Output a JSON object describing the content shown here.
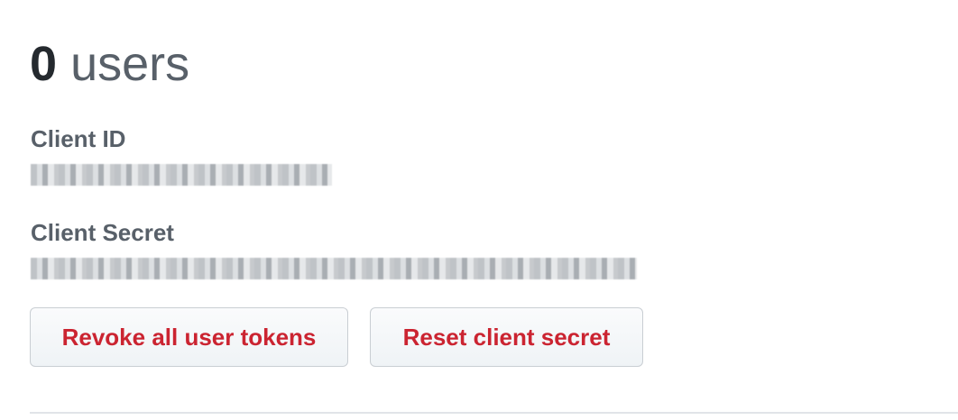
{
  "summary": {
    "count": "0",
    "unit": "users"
  },
  "client_id": {
    "label": "Client ID"
  },
  "client_secret": {
    "label": "Client Secret"
  },
  "actions": {
    "revoke_label": "Revoke all user tokens",
    "reset_label": "Reset client secret"
  },
  "colors": {
    "danger": "#cb2431",
    "heading": "#24292e",
    "muted": "#586069"
  }
}
